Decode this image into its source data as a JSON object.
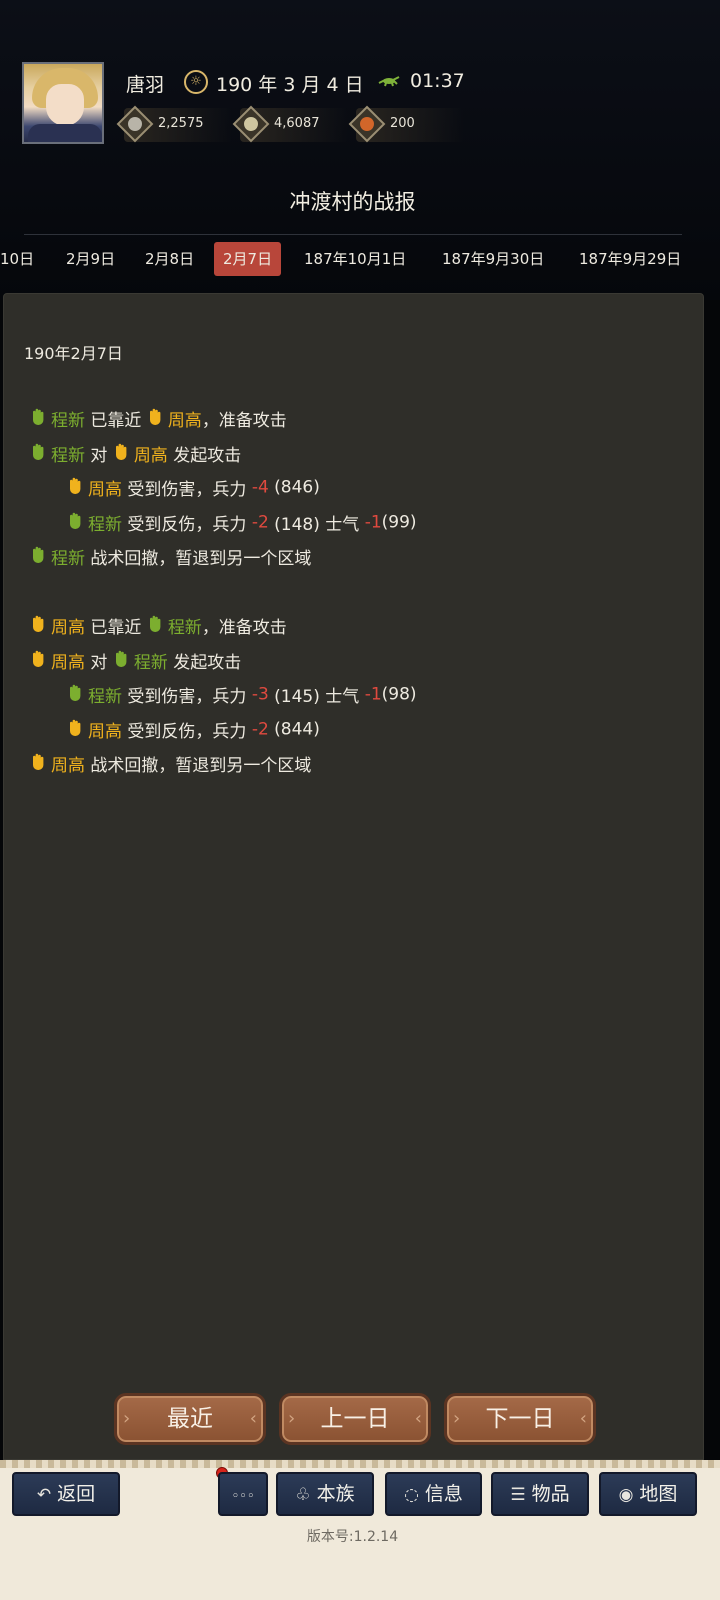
{
  "header": {
    "player_name": "唐羽",
    "date_icon": "calendar-icon",
    "game_date": "190 年 3 月 4 日",
    "time_icon": "cricket-icon",
    "game_time": "01:37",
    "resources": [
      {
        "icon": "silver-coin-icon",
        "value": "2,2575",
        "color": "#b8b4a8"
      },
      {
        "icon": "grain-icon",
        "value": "4,6087",
        "color": "#cfc6a0"
      },
      {
        "icon": "token-icon",
        "value": "200",
        "color": "#d2662a"
      }
    ]
  },
  "title": "冲渡村的战报",
  "date_tabs": [
    {
      "label": "10日"
    },
    {
      "label": "2月9日"
    },
    {
      "label": "2月8日"
    },
    {
      "label": "2月7日",
      "active": true
    },
    {
      "label": "187年10月1日"
    },
    {
      "label": "187年9月30日"
    },
    {
      "label": "187年9月29日"
    }
  ],
  "report": {
    "date": "190年2月7日",
    "lines": [
      {
        "a": "程新",
        "t1": "已靠近",
        "b": "周高",
        "t2": "，准备攻击"
      },
      {
        "a": "程新",
        "t1": "对",
        "b": "周高",
        "t2": "发起攻击"
      },
      {
        "a": "周高",
        "t1": "受到伤害，兵力",
        "n1": "-4",
        "p1": "(846)"
      },
      {
        "a": "程新",
        "t1": "受到反伤，兵力",
        "n1": "-2",
        "p1": "(148) 士气",
        "n2": "-1",
        "p2": "(99)"
      },
      {
        "a": "程新",
        "t1": "战术回撤，暂退到另一个区域"
      },
      {
        "a": "周高",
        "t1": "已靠近",
        "b": "程新",
        "t2": "，准备攻击"
      },
      {
        "a": "周高",
        "t1": "对",
        "b": "程新",
        "t2": "发起攻击"
      },
      {
        "a": "程新",
        "t1": "受到伤害，兵力",
        "n1": "-3",
        "p1": "(145) 士气",
        "n2": "-1",
        "p2": "(98)"
      },
      {
        "a": "周高",
        "t1": "受到反伤，兵力",
        "n1": "-2",
        "p1": "(844)"
      },
      {
        "a": "周高",
        "t1": "战术回撤，暂退到另一个区域"
      }
    ]
  },
  "pager": {
    "latest": "最近",
    "prev": "上一日",
    "next": "下一日"
  },
  "nav": {
    "back": "返回",
    "more": "◦◦◦",
    "clan": "本族",
    "info": "信息",
    "items": "物品",
    "map": "地图"
  },
  "version": "版本号:1.2.14",
  "colors": {
    "green": "#7cae2f",
    "yellow": "#f0b21d",
    "negative": "#e04a3f",
    "active_tab": "#b8463a"
  }
}
